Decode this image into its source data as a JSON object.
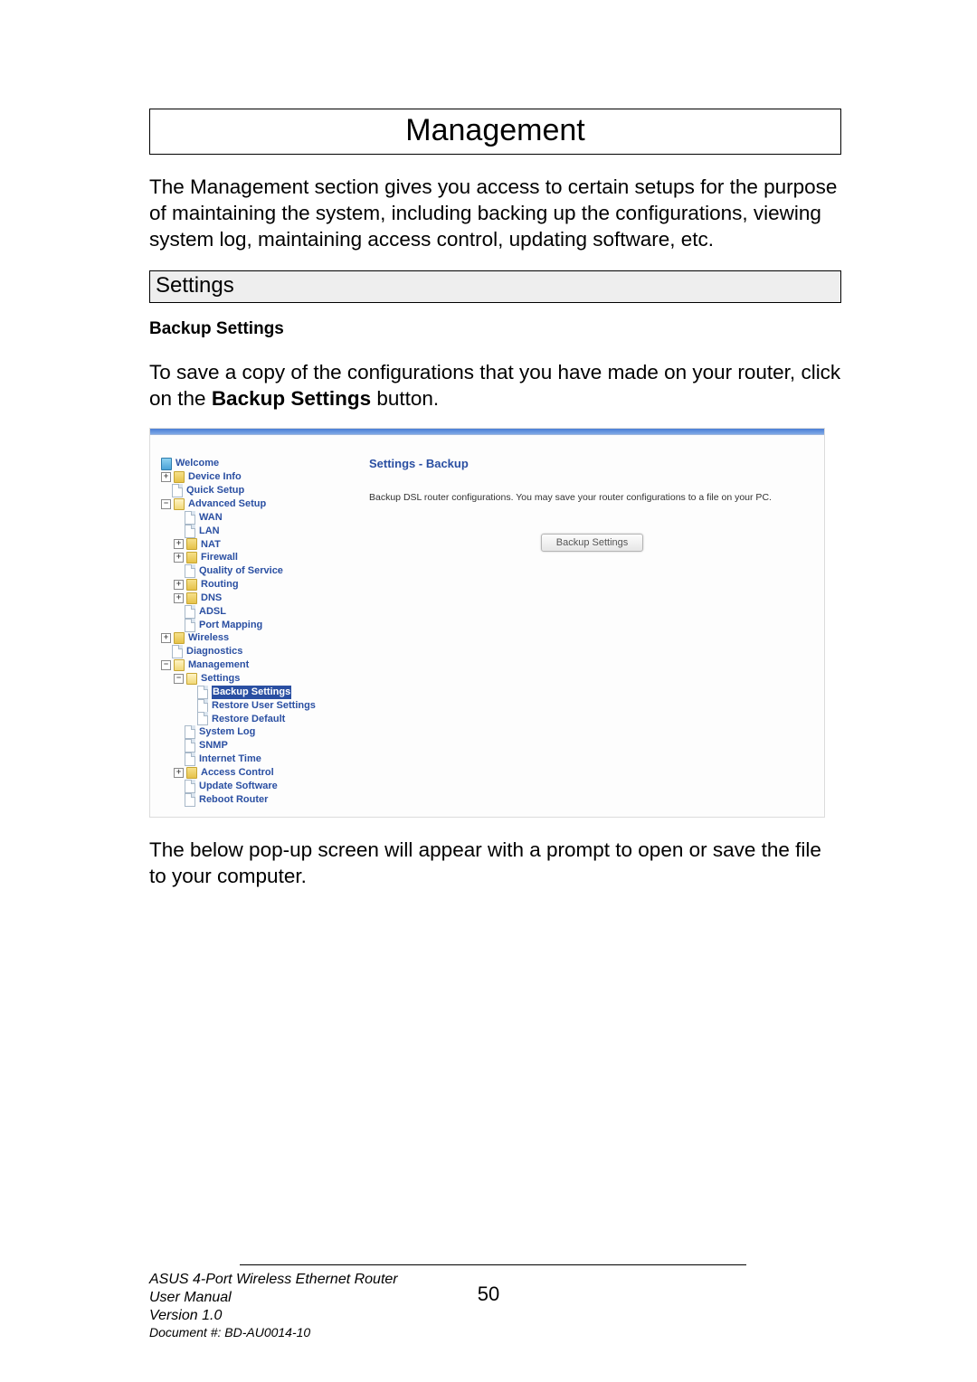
{
  "title": "Management",
  "intro": "The Management section gives you access to certain setups for the purpose of maintaining the system, including backing up the configurations, viewing system log, maintaining access control, updating software, etc.",
  "section_header": "Settings",
  "subhead": "Backup Settings",
  "instruction_pre": "To save a copy of the configurations that you have made on your router, click on the ",
  "instruction_bold": "Backup Settings",
  "instruction_post": " button.",
  "after_text": "The below pop-up screen will appear with a prompt to open or save the file to your computer.",
  "screenshot": {
    "tree": {
      "welcome": "Welcome",
      "device_info": "Device Info",
      "quick_setup": "Quick Setup",
      "advanced_setup": "Advanced Setup",
      "wan": "WAN",
      "lan": "LAN",
      "nat": "NAT",
      "firewall": "Firewall",
      "qos": "Quality of Service",
      "routing": "Routing",
      "dns": "DNS",
      "adsl": "ADSL",
      "port_mapping": "Port Mapping",
      "wireless": "Wireless",
      "diagnostics": "Diagnostics",
      "management": "Management",
      "settings": "Settings",
      "backup_settings": "Backup Settings",
      "restore_user": "Restore User Settings",
      "restore_default": "Restore Default",
      "system_log": "System Log",
      "snmp": "SNMP",
      "internet_time": "Internet Time",
      "access_control": "Access Control",
      "update_software": "Update Software",
      "reboot_router": "Reboot Router"
    },
    "panel": {
      "title": "Settings - Backup",
      "text": "Backup DSL router configurations. You may save your router configurations to a file on your PC.",
      "button": "Backup Settings"
    }
  },
  "footer": {
    "product": "ASUS 4-Port Wireless Ethernet Router",
    "manual": "User Manual",
    "version": "Version 1.0",
    "document": "Document #:  BD-AU0014-10",
    "page_number": "50"
  }
}
